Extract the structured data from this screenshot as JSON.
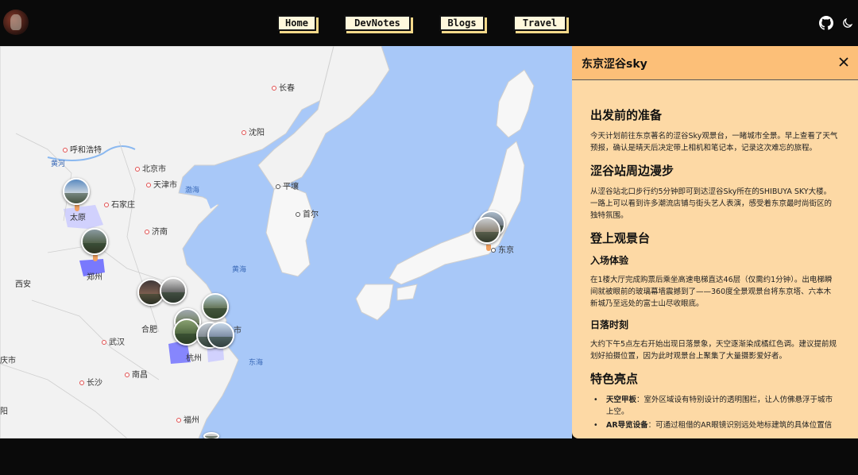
{
  "nav": {
    "items": [
      {
        "label": "Home"
      },
      {
        "label": "DevNotes"
      },
      {
        "label": "Blogs"
      },
      {
        "label": "Travel"
      }
    ]
  },
  "header": {
    "github_icon": "github-icon",
    "theme_icon": "moon-icon"
  },
  "map": {
    "cities": [
      {
        "name": "长春",
        "type": "red"
      },
      {
        "name": "沈阳",
        "type": "red"
      },
      {
        "name": "呼和浩特",
        "type": "red"
      },
      {
        "name": "北京市",
        "type": "red"
      },
      {
        "name": "天津市",
        "type": "red"
      },
      {
        "name": "石家庄",
        "type": "red"
      },
      {
        "name": "太原",
        "type": "plain"
      },
      {
        "name": "济南",
        "type": "red"
      },
      {
        "name": "郑州",
        "type": "plain"
      },
      {
        "name": "西安",
        "type": "plain"
      },
      {
        "name": "合肥",
        "type": "red"
      },
      {
        "name": "武汉",
        "type": "red"
      },
      {
        "name": "南昌",
        "type": "red"
      },
      {
        "name": "长沙",
        "type": "red"
      },
      {
        "name": "杭州",
        "type": "plain"
      },
      {
        "name": "福州",
        "type": "red"
      },
      {
        "name": "平壤",
        "type": "plain"
      },
      {
        "name": "首尔",
        "type": "plain"
      },
      {
        "name": "东京",
        "type": "plain"
      },
      {
        "name": "市",
        "type": "plain"
      },
      {
        "name": "庆市",
        "type": "plain"
      },
      {
        "name": "阳",
        "type": "plain"
      }
    ],
    "seas": [
      "黄河",
      "渤海",
      "黄海",
      "东海"
    ]
  },
  "panel": {
    "title": "东京涩谷sky",
    "close_icon": "close-icon",
    "sections": {
      "s1_title": "出发前的准备",
      "s1_text": "今天计划前往东京著名的涩谷Sky观景台，一睹城市全景。早上查看了天气预报，确认是晴天后决定带上相机和笔记本，记录这次难忘的旅程。",
      "s2_title": "涩谷站周边漫步",
      "s2_text": "从涩谷站北口步行约5分钟即可到达涩谷Sky所在的SHIBUYA SKY大楼。一路上可以看到许多潮流店铺与街头艺人表演，感受着东京最时尚街区的独特氛围。",
      "s3_title": "登上观景台",
      "s3a_title": "入场体验",
      "s3a_text": "在1楼大厅完成购票后乘坐高速电梯直达46层（仅需约1分钟）。出电梯瞬间就被眼前的玻璃幕墙震撼到了——360度全景观景台将东京塔、六本木新城乃至远处的富士山尽收眼底。",
      "s3b_title": "日落时刻",
      "s3b_text": "大约下午5点左右开始出现日落景象，天空逐渐染成橘红色调。建议提前规划好拍摄位置，因为此时观景台上聚集了大量摄影爱好者。",
      "s4_title": "特色亮点",
      "s4_items": [
        {
          "label": "天空甲板",
          "text": "：室外区域设有特别设计的透明围栏，让人仿佛悬浮于城市上空。"
        },
        {
          "label": "AR导览设备",
          "text": "：可通过租借的AR眼镜识别远处地标建筑的具体位置信"
        }
      ]
    }
  }
}
